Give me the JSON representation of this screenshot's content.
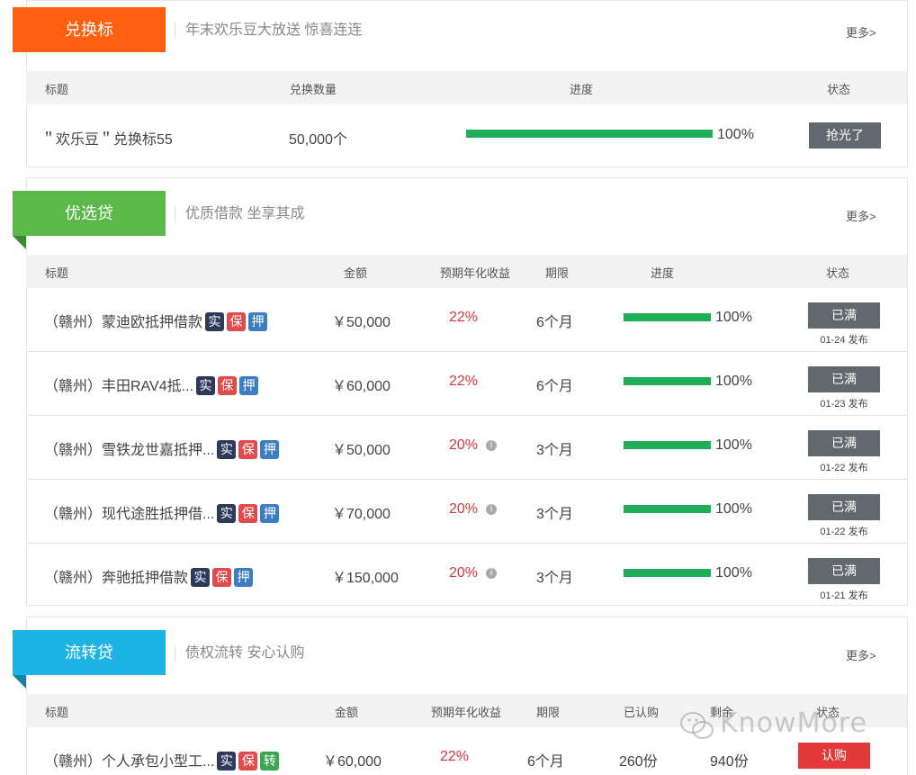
{
  "colors": {
    "orange": "#ff5f0f",
    "green": "#5cb848",
    "blue": "#1db4e5",
    "progress": "#1fad5a",
    "rate": "#d9363e",
    "btn_gray": "#626870",
    "btn_red": "#e23a3a"
  },
  "exchange": {
    "badge": "兑换标",
    "subtitle": "年末欢乐豆大放送 惊喜连连",
    "more": "更多>",
    "headers": {
      "title": "标题",
      "qty": "兑换数量",
      "progress": "进度",
      "status": "状态"
    },
    "rows": [
      {
        "title": "＂欢乐豆＂兑换标55",
        "qty": "50,000个",
        "progress": 1.0,
        "progress_text": "100%",
        "status": "抢光了"
      }
    ]
  },
  "preferred": {
    "badge": "优选贷",
    "subtitle": "优质借款 坐享其成",
    "more": "更多>",
    "headers": {
      "title": "标题",
      "amount": "金额",
      "rate": "预期年化收益",
      "term": "期限",
      "progress": "进度",
      "status": "状态"
    },
    "rows": [
      {
        "title": "（赣州）蒙迪欧抵押借款",
        "tags": [
          "实",
          "保",
          "押"
        ],
        "amount": "￥50,000",
        "rate": "22%",
        "info": false,
        "term": "6个月",
        "progress": 1.0,
        "progress_text": "100%",
        "status": "已满",
        "date": "01-24 发布"
      },
      {
        "title": "（赣州）丰田RAV4抵...",
        "tags": [
          "实",
          "保",
          "押"
        ],
        "amount": "￥60,000",
        "rate": "22%",
        "info": false,
        "term": "6个月",
        "progress": 1.0,
        "progress_text": "100%",
        "status": "已满",
        "date": "01-23 发布"
      },
      {
        "title": "（赣州）雪铁龙世嘉抵押...",
        "tags": [
          "实",
          "保",
          "押"
        ],
        "amount": "￥50,000",
        "rate": "20%",
        "info": true,
        "term": "3个月",
        "progress": 1.0,
        "progress_text": "100%",
        "status": "已满",
        "date": "01-22 发布"
      },
      {
        "title": "（赣州）现代途胜抵押借...",
        "tags": [
          "实",
          "保",
          "押"
        ],
        "amount": "￥70,000",
        "rate": "20%",
        "info": true,
        "term": "3个月",
        "progress": 1.0,
        "progress_text": "100%",
        "status": "已满",
        "date": "01-22 发布"
      },
      {
        "title": "（赣州）奔驰抵押借款",
        "tags": [
          "实",
          "保",
          "押"
        ],
        "amount": "￥150,000",
        "rate": "20%",
        "info": true,
        "term": "3个月",
        "progress": 1.0,
        "progress_text": "100%",
        "status": "已满",
        "date": "01-21 发布"
      }
    ]
  },
  "transfer": {
    "badge": "流转贷",
    "subtitle": "债权流转 安心认购",
    "more": "更多>",
    "headers": {
      "title": "标题",
      "amount": "金额",
      "rate": "预期年化收益",
      "term": "期限",
      "bought": "已认购",
      "remaining": "剩余",
      "status": "状态"
    },
    "rows": [
      {
        "title": "（赣州）个人承包小型工...",
        "tags": [
          "实",
          "保",
          "转"
        ],
        "amount": "￥60,000",
        "rate": "22%",
        "term": "6个月",
        "bought": "260份",
        "remaining": "940份",
        "status": "认购"
      }
    ]
  },
  "watermark": "KnowMore"
}
